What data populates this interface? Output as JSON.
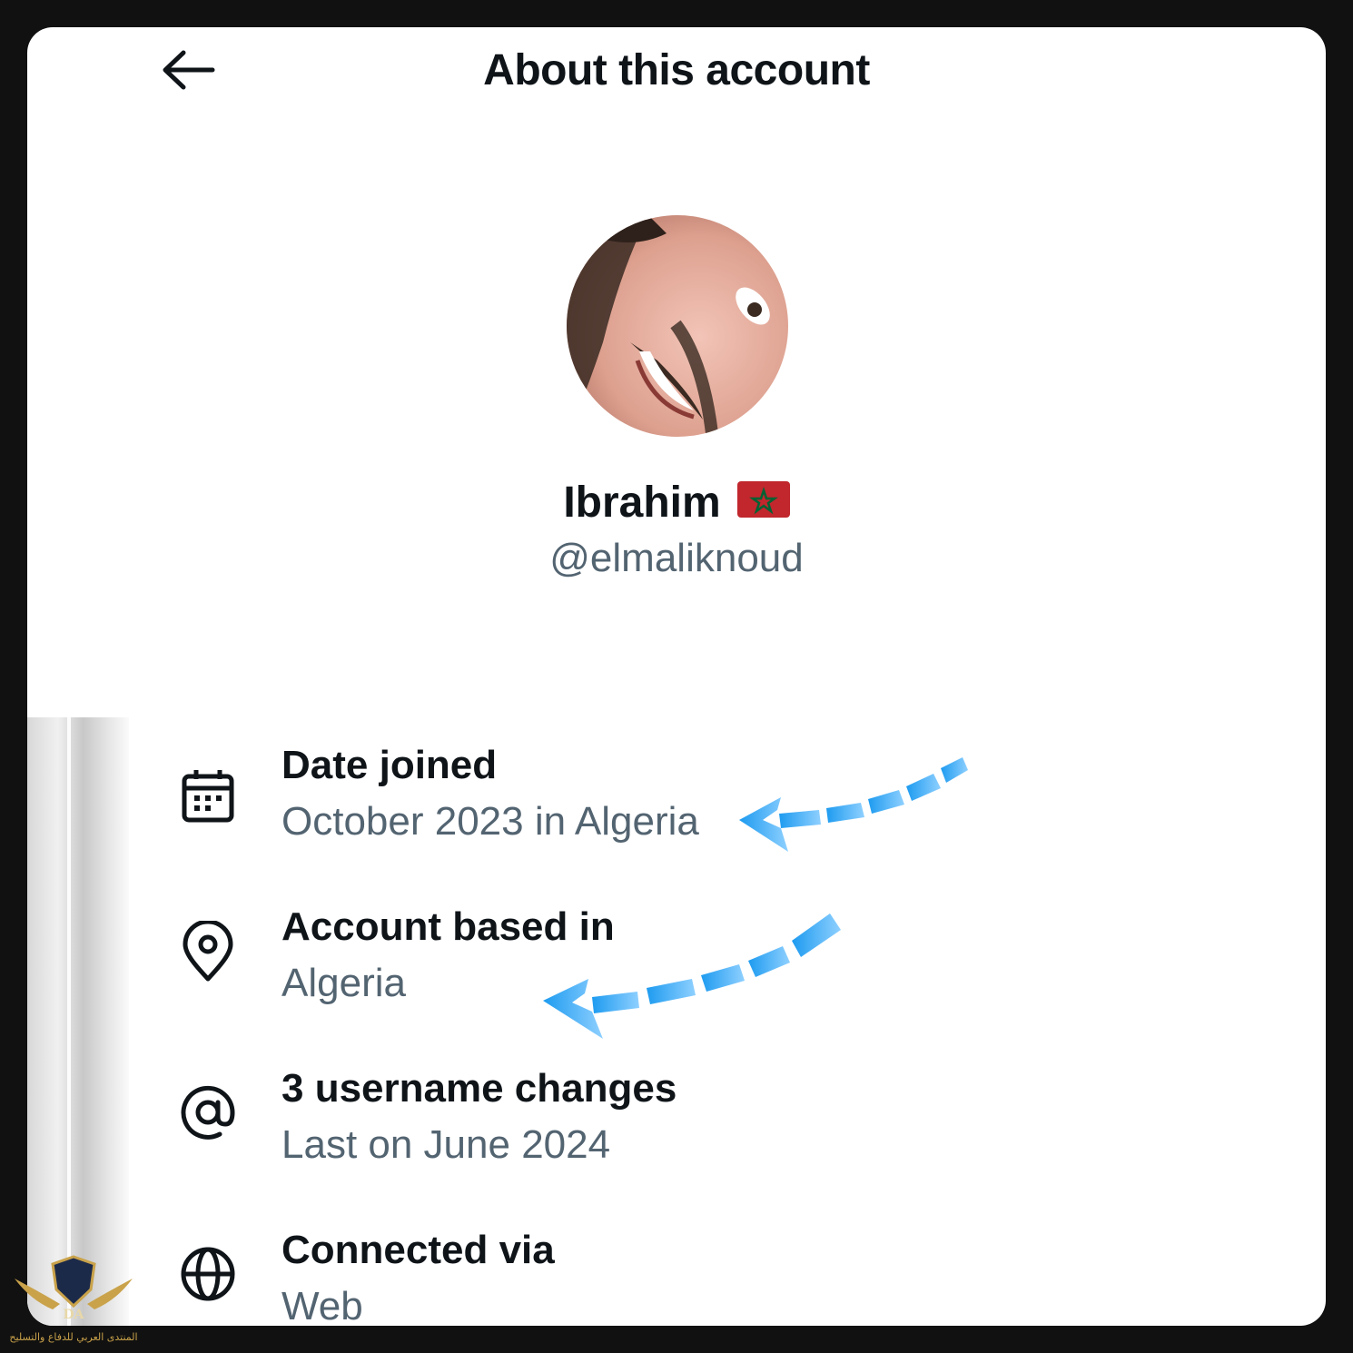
{
  "header": {
    "title": "About this account",
    "back_icon": "arrow-left-icon"
  },
  "profile": {
    "name": "Ibrahim",
    "flag": "morocco-flag-icon",
    "handle": "@elmaliknoud"
  },
  "items": [
    {
      "icon": "calendar-icon",
      "label": "Date joined",
      "value": "October 2023 in Algeria"
    },
    {
      "icon": "location-pin-icon",
      "label": "Account based in",
      "value": "Algeria"
    },
    {
      "icon": "at-sign-icon",
      "label": "3 username changes",
      "value": "Last on June 2024"
    },
    {
      "icon": "globe-icon",
      "label": "Connected via",
      "value": "Web"
    }
  ],
  "watermark": {
    "text": "المنتدى العربي للدفاع والتسليح",
    "logo": "DA"
  },
  "colors": {
    "primary_text": "#0f1419",
    "secondary_text": "#536471",
    "annotation_arrow": "#1d9bf0"
  }
}
